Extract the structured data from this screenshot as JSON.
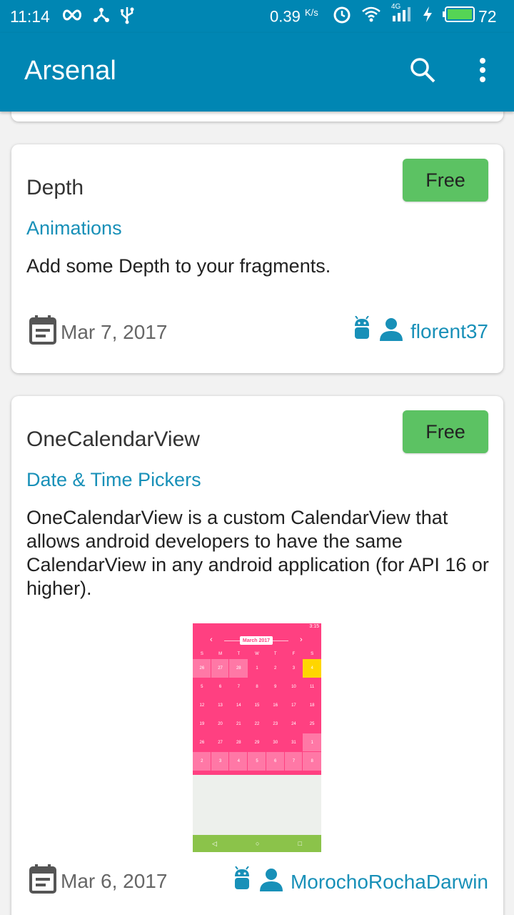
{
  "status_bar": {
    "time": "11:14",
    "speed": "0.39",
    "speed_unit": "K/s",
    "network": "4G",
    "battery": "72",
    "icons": [
      "infinity-icon",
      "share-icon",
      "usb-icon",
      "alarm-icon",
      "wifi-icon",
      "signal-icon",
      "charging-icon",
      "battery-icon"
    ]
  },
  "app_bar": {
    "title": "Arsenal",
    "icons": [
      "search-icon",
      "more-vert-icon"
    ],
    "color": "#0086b3"
  },
  "cards": [
    {
      "title": "Depth",
      "price": "Free",
      "category": "Animations",
      "description": "Add some Depth to your fragments.",
      "date": "Mar 7, 2017",
      "author": "florent37"
    },
    {
      "title": "OneCalendarView",
      "price": "Free",
      "category": "Date & Time Pickers",
      "description": "OneCalendarView is a custom CalendarView that allows android developers to have the same CalendarView in any android application (for API 16 or higher).",
      "date": "Mar 6, 2017",
      "author": "MorochoRochaDarwin"
    }
  ],
  "preview": {
    "month": "March 2017",
    "status_time": "3:15",
    "days_of_week": [
      "S",
      "M",
      "T",
      "W",
      "T",
      "F",
      "S"
    ],
    "days": [
      "26",
      "27",
      "28",
      "1",
      "2",
      "3",
      "4",
      "5",
      "6",
      "7",
      "8",
      "9",
      "10",
      "11",
      "12",
      "13",
      "14",
      "15",
      "16",
      "17",
      "18",
      "19",
      "20",
      "21",
      "22",
      "23",
      "24",
      "25",
      "26",
      "27",
      "28",
      "29",
      "30",
      "31",
      "1",
      "2",
      "3",
      "4",
      "5",
      "6",
      "7",
      "8"
    ]
  },
  "colors": {
    "accent": "#1890b8",
    "free_button": "#5cc263",
    "calendar_pink": "#ff4081",
    "highlight": "#ffd600"
  }
}
